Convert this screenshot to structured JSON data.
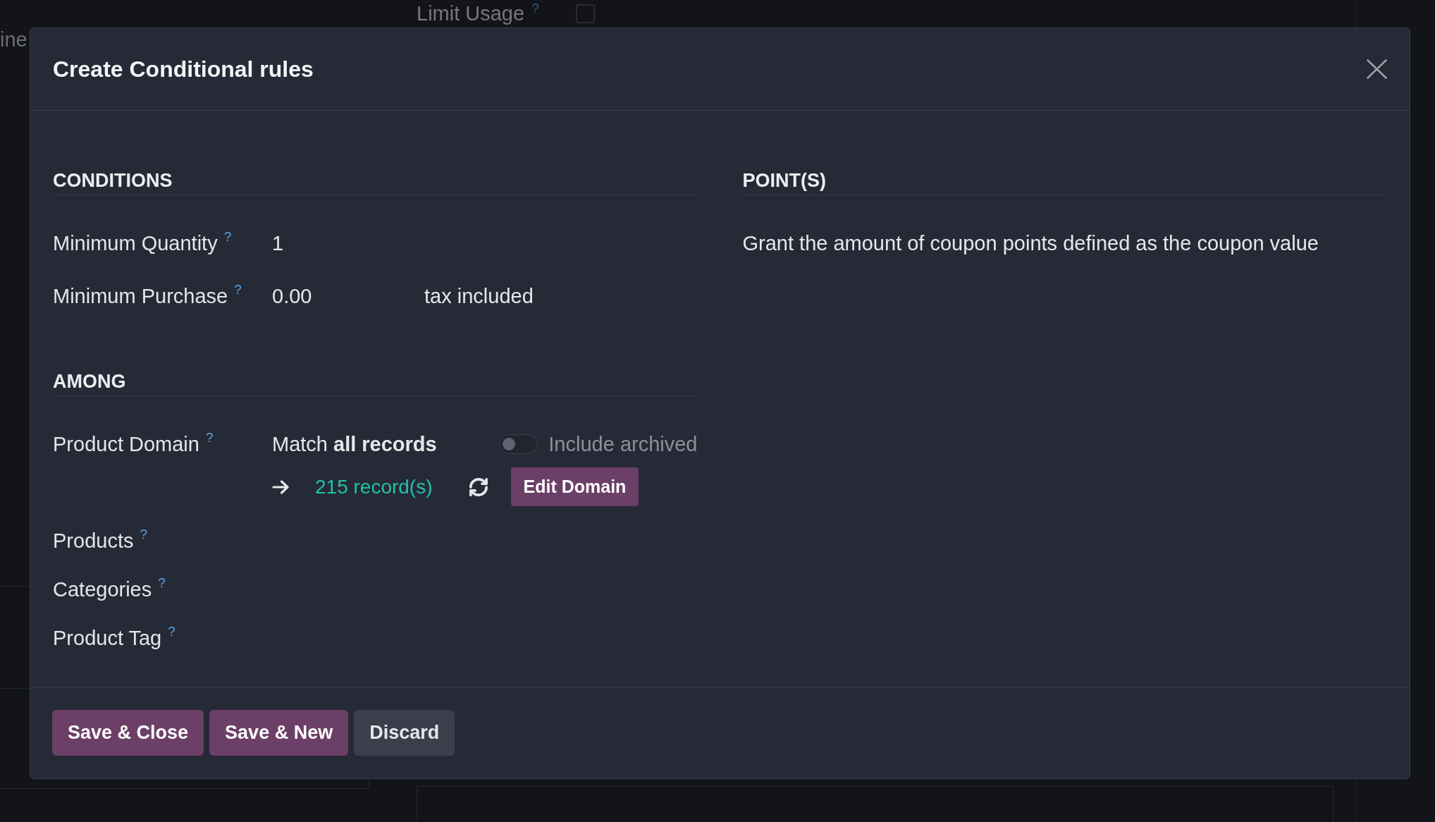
{
  "background_form": {
    "cut_label": "ine",
    "limit_usage": {
      "label": "Limit Usage",
      "help": "?",
      "checked": false
    }
  },
  "dialog": {
    "title": "Create Conditional rules",
    "sections": [
      {
        "heading": "CONDITIONS",
        "fields": [
          {
            "kind": "plain",
            "label": "Minimum Quantity",
            "help": "?",
            "value": "1"
          },
          {
            "kind": "plain",
            "label": "Minimum Purchase",
            "help": "?",
            "value": "0.00",
            "suffix": "tax included"
          }
        ]
      },
      {
        "heading": "AMONG",
        "fields": [
          {
            "kind": "domain",
            "label": "Product Domain",
            "help": "?",
            "summary": "Match **all records**",
            "include_archived": {
              "label": "Include archived",
              "on": false
            },
            "records": "215 record(s)",
            "button": "Edit Domain"
          },
          {
            "kind": "plain",
            "label": "Products",
            "help": "?"
          },
          {
            "kind": "plain",
            "label": "Categories",
            "help": "?"
          },
          {
            "kind": "plain",
            "label": "Product Tag",
            "help": "?"
          }
        ]
      }
    ],
    "points": {
      "heading": "POINT(S)",
      "text": "Grant the amount of coupon points defined as the coupon value"
    },
    "buttons": [
      {
        "kind": "primary",
        "label": "Save & Close"
      },
      {
        "kind": "primary",
        "label": "Save & New"
      },
      {
        "kind": "secondary",
        "label": "Discard"
      }
    ]
  }
}
